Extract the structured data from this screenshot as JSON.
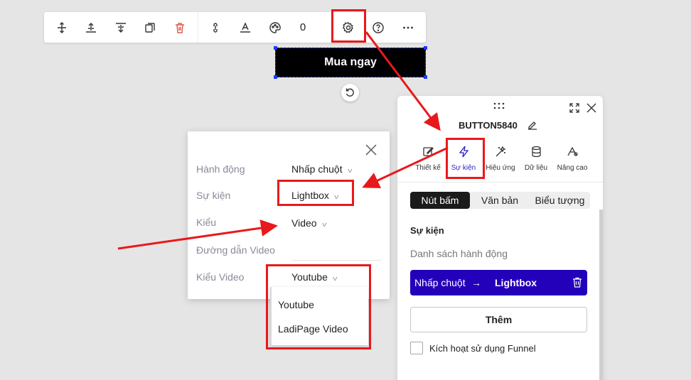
{
  "toolbar": {
    "counter": "0",
    "icons": [
      "align-center-vertical-icon",
      "align-top-icon",
      "align-bottom-icon",
      "duplicate-icon",
      "delete-icon",
      "link-icon",
      "text-style-icon",
      "palette-icon",
      "gear-icon",
      "help-icon",
      "more-icon"
    ]
  },
  "canvas_button": {
    "label": "Mua ngay"
  },
  "panel": {
    "title": "BUTTON5840",
    "tabs": [
      {
        "label": "Thiết kế",
        "icon": "edit-icon"
      },
      {
        "label": "Sự kiện",
        "icon": "lightning-icon",
        "active": true
      },
      {
        "label": "Hiệu ứng",
        "icon": "magic-wand-icon"
      },
      {
        "label": "Dữ liệu",
        "icon": "database-icon"
      },
      {
        "label": "Nâng cao",
        "icon": "advanced-settings-icon"
      }
    ],
    "segments": [
      "Nút bấm",
      "Văn bản",
      "Biểu tượng"
    ],
    "section_title": "Sự kiện",
    "action_list_label": "Danh sách hành động",
    "action": {
      "trigger": "Nhấp chuột",
      "arrow": "→",
      "target": "Lightbox"
    },
    "add_label": "Thêm",
    "funnel_label": "Kích hoạt sử dụng Funnel"
  },
  "popup": {
    "rows": [
      {
        "label": "Hành động",
        "value": "Nhấp chuột"
      },
      {
        "label": "Sự kiện",
        "value": "Lightbox"
      },
      {
        "label": "Kiểu",
        "value": "Video"
      },
      {
        "label": "Đường dẫn Video",
        "value": ""
      },
      {
        "label": "Kiểu Video",
        "value": "Youtube"
      }
    ],
    "video_options": [
      "Youtube",
      "LadiPage Video"
    ]
  },
  "colors": {
    "accent": "#2300b9",
    "annotation": "#e8191c",
    "active_tab": "#2b1fbf"
  }
}
